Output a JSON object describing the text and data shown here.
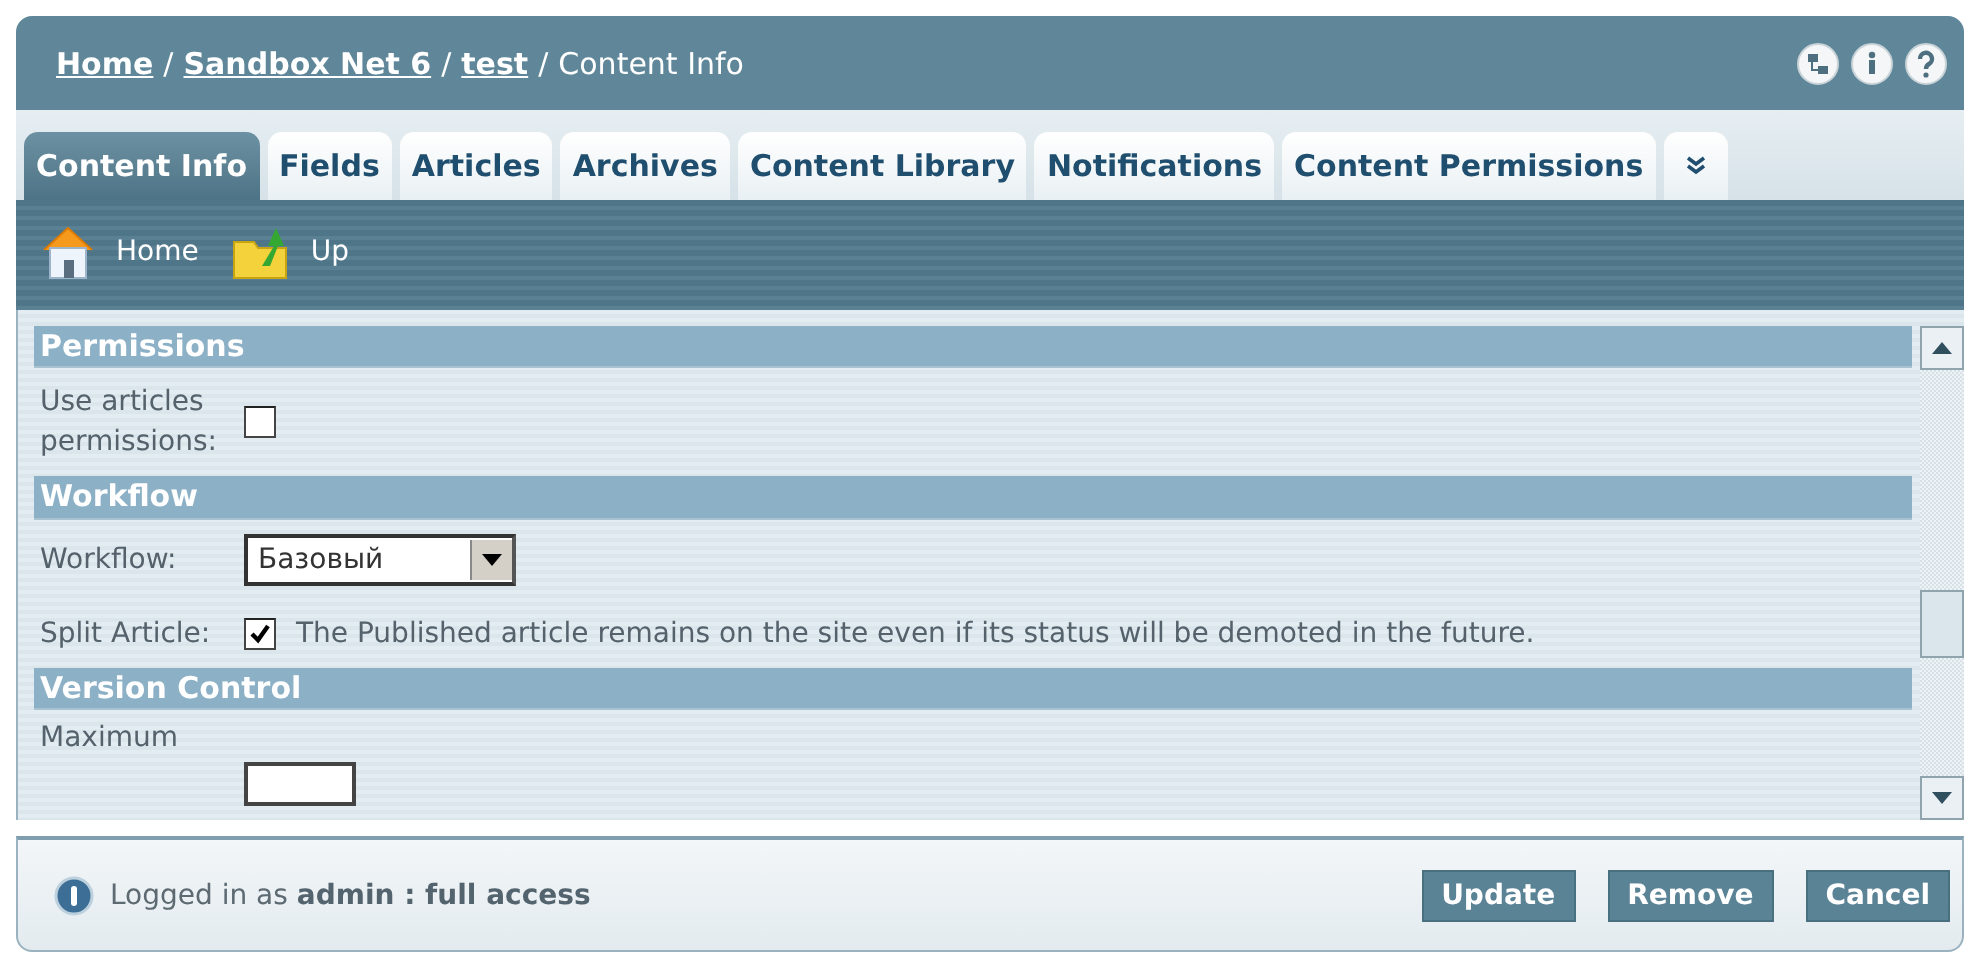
{
  "breadcrumb": [
    {
      "kind": "link",
      "label": "Home"
    },
    {
      "kind": "separator",
      "label": "/"
    },
    {
      "kind": "link",
      "label": "Sandbox Net 6"
    },
    {
      "kind": "separator",
      "label": "/"
    },
    {
      "kind": "link",
      "label": "test"
    },
    {
      "kind": "separator",
      "label": "/"
    },
    {
      "kind": "current",
      "label": "Content Info"
    }
  ],
  "tabs": [
    {
      "label": "Content Info",
      "selected": true
    },
    {
      "label": "Fields",
      "selected": false
    },
    {
      "label": "Articles",
      "selected": false
    },
    {
      "label": "Archives",
      "selected": false
    },
    {
      "label": "Content Library",
      "selected": false
    },
    {
      "label": "Notifications",
      "selected": false
    },
    {
      "label": "Content Permissions",
      "selected": false
    }
  ],
  "toolbar": [
    {
      "label": "Home",
      "kind": "home"
    },
    {
      "label": "Up",
      "kind": "up"
    }
  ],
  "sections": [
    {
      "title": "Permissions",
      "fields": [
        {
          "kind": "checkbox",
          "label": "Use articles permissions:",
          "checked": false
        }
      ]
    },
    {
      "title": "Workflow",
      "fields": [
        {
          "kind": "select",
          "label": "Workflow:",
          "value": "Базовый"
        },
        {
          "kind": "checkbox",
          "label": "Split Article:",
          "checked": true,
          "description": "The Published article remains on the site even if its status will be demoted in the future."
        }
      ]
    },
    {
      "title": "Version Control",
      "fields": [
        {
          "kind": "text",
          "label": "Maximum"
        }
      ]
    }
  ],
  "status": "Logged in as **admin : full access**",
  "buttons": [
    "Update",
    "Remove",
    "Cancel"
  ]
}
